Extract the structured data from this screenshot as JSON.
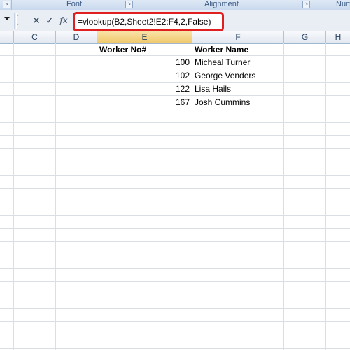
{
  "ribbon": {
    "groups": [
      {
        "label": "Font"
      },
      {
        "label": "Alignment"
      },
      {
        "label": "Num"
      }
    ]
  },
  "formula_bar": {
    "cancel_glyph": "✕",
    "enter_glyph": "✓",
    "fx_label": "fx",
    "formula": "=vlookup(B2,Sheet2!E2:F4,2,False)"
  },
  "columns": [
    "C",
    "D",
    "E",
    "F",
    "G",
    "H"
  ],
  "sheet": {
    "header_row": {
      "E": "Worker No#",
      "F": "Worker Name"
    },
    "rows": [
      {
        "E": "100",
        "F": "Micheal Turner"
      },
      {
        "E": "102",
        "F": "George Venders"
      },
      {
        "E": "122",
        "F": "Lisa Hails"
      },
      {
        "E": "167",
        "F": "Josh Cummins"
      }
    ]
  },
  "colors": {
    "highlight_border": "#e02020",
    "selected_header": "#f0c86a",
    "gridline": "#dadfe6"
  }
}
